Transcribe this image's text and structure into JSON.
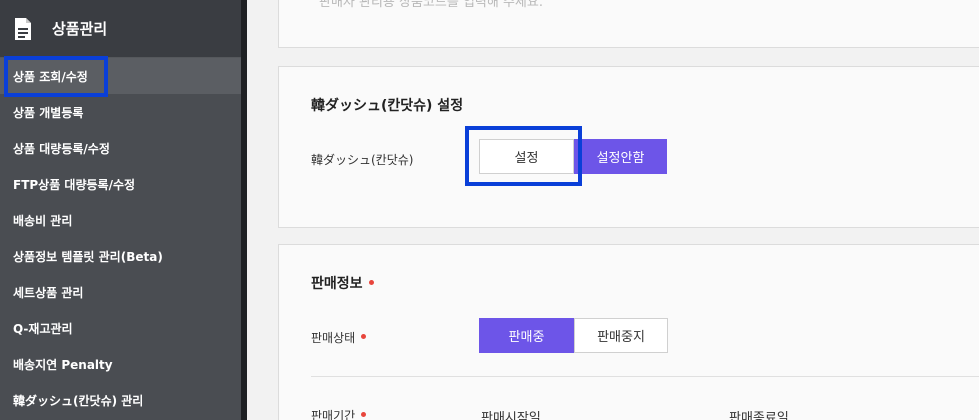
{
  "sidebar": {
    "title": "상품관리",
    "items": [
      {
        "label": "상품 조회/수정"
      },
      {
        "label": "상품 개별등록"
      },
      {
        "label": "상품 대량등록/수정"
      },
      {
        "label": "FTP상품 대량등록/수정"
      },
      {
        "label": "배송비 관리"
      },
      {
        "label": "상품정보 템플릿 관리(Beta)"
      },
      {
        "label": "세트상품 관리"
      },
      {
        "label": "Q-재고관리"
      },
      {
        "label": "배송지연 Penalty"
      },
      {
        "label": "韓ダッシュ(칸닷슈) 관리"
      }
    ]
  },
  "top_card": {
    "placeholder": "판매자 관리용 상품코드를 입력해 주세요."
  },
  "kandash_card": {
    "title": "韓ダッシュ(칸닷슈) 설정",
    "field_label": "韓ダッシュ(칸닷슈)",
    "set_label": "설정",
    "unset_label": "설정안함"
  },
  "sales_card": {
    "title": "판매정보",
    "status_label": "판매상태",
    "on_sale_label": "판매중",
    "stop_sale_label": "판매중지",
    "period_label": "판매기간",
    "start_label": "판매시작일",
    "end_label": "판매종료일"
  },
  "colors": {
    "accent": "#6d55e8",
    "highlight": "#0a3fd8",
    "required": "#e8453c"
  }
}
